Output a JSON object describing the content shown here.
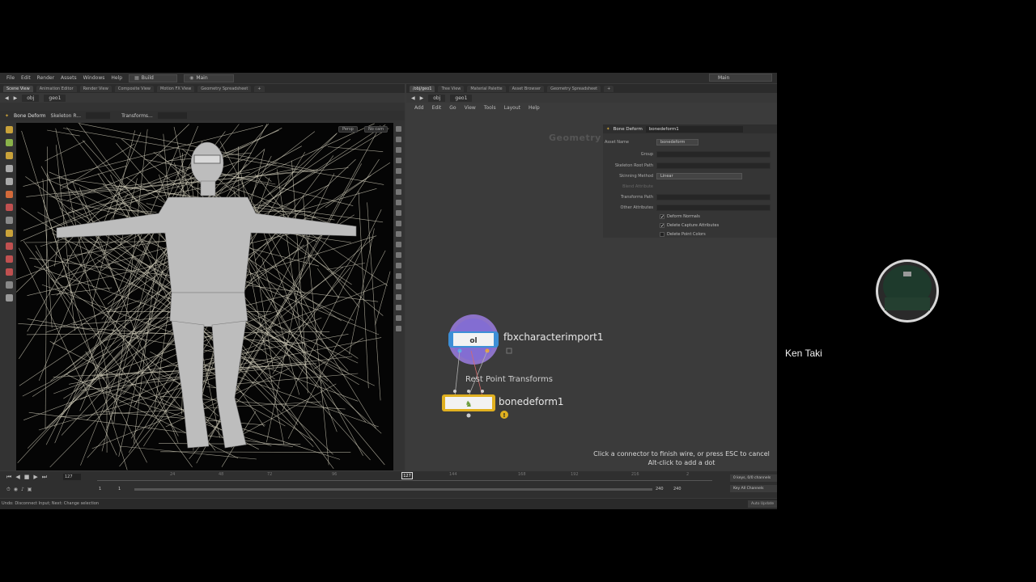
{
  "colors": {
    "accent_yellow": "#c9a23a",
    "node_purple": "#9b7de0",
    "node_blue": "#3d8fd6",
    "wire": "#b0b0b0",
    "warning": "#e0b020"
  },
  "menubar": {
    "items": [
      "File",
      "Edit",
      "Render",
      "Assets",
      "Windows",
      "Help"
    ],
    "desktop": "Build",
    "main": "Main",
    "right_label": "Main"
  },
  "left_tabs": [
    "Scene View",
    "Animation Editor",
    "Render View",
    "Composite View",
    "Motion FX View",
    "Geometry Spreadsheet"
  ],
  "left_path": {
    "obj": "obj",
    "geo": "geo1"
  },
  "viewport_toolbar": {
    "op": "Bone Deform",
    "selection": "Skeleton R...",
    "transforms": "Transforms..."
  },
  "viewport": {
    "persp": "Persp",
    "cam": "No cam"
  },
  "right_tabs": [
    "/obj/geo1",
    "Tree View",
    "Material Palette",
    "Asset Browser",
    "Geometry Spreadsheet"
  ],
  "right_path": {
    "obj": "obj",
    "geo": "geo1"
  },
  "network_menu": [
    "Add",
    "Edit",
    "Go",
    "View",
    "Tools",
    "Layout",
    "Help"
  ],
  "network_context": "Geometry",
  "params": {
    "op_type": "Bone Deform",
    "node_name": "bonedeform1",
    "asset_name_label": "Asset Name",
    "asset_name_value": "bonedeform",
    "group_label": "Group",
    "skeleton_root_label": "Skeleton Root Path",
    "skinning_method_label": "Skinning Method",
    "skinning_method_value": "Linear",
    "blend_attribute_label": "Blend Attribute",
    "transforms_path_label": "Transforms Path",
    "other_attributes_label": "Other Attributes",
    "deform_normals": "Deform Normals",
    "delete_capture": "Delete Capture Attributes",
    "delete_point_colors": "Delete Point Colors"
  },
  "nodes": {
    "fbx": "fbxcharacterimport1",
    "rest": "Rest Point Transforms",
    "bone": "bonedeform1"
  },
  "hint": {
    "line1": "Click a connector to finish wire, or press ESC to cancel",
    "line2": "Alt-click to add a dot"
  },
  "timeline": {
    "current_frame": "127",
    "start": "1",
    "start2": "1",
    "end": "240",
    "end2": "240",
    "marker": "127",
    "ticks": [
      "24",
      "48",
      "72",
      "96",
      "120",
      "144",
      "168",
      "192",
      "216",
      "2"
    ],
    "keys_label": "0 keys, 0/0 channels",
    "key_all": "Key All Channels",
    "auto_update": "Auto Update"
  },
  "status": "Undo: Disconnect Input; Next: Change selection",
  "webcam": {
    "name": "Ken Taki"
  }
}
